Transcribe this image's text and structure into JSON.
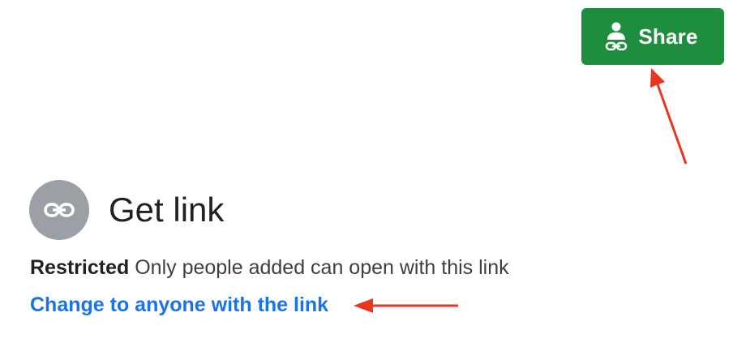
{
  "share_button": {
    "label": "Share",
    "icon": "person-link-icon",
    "color": "#1e8e3e"
  },
  "get_link": {
    "title": "Get link",
    "icon": "link-icon",
    "icon_bg_color": "#9aa0a6"
  },
  "access": {
    "level": "Restricted",
    "description": "Only people added can open with this link"
  },
  "change_link": {
    "label": "Change to anyone with the link",
    "color": "#1a73e8"
  },
  "annotations": {
    "arrow_color": "#e8361f"
  }
}
